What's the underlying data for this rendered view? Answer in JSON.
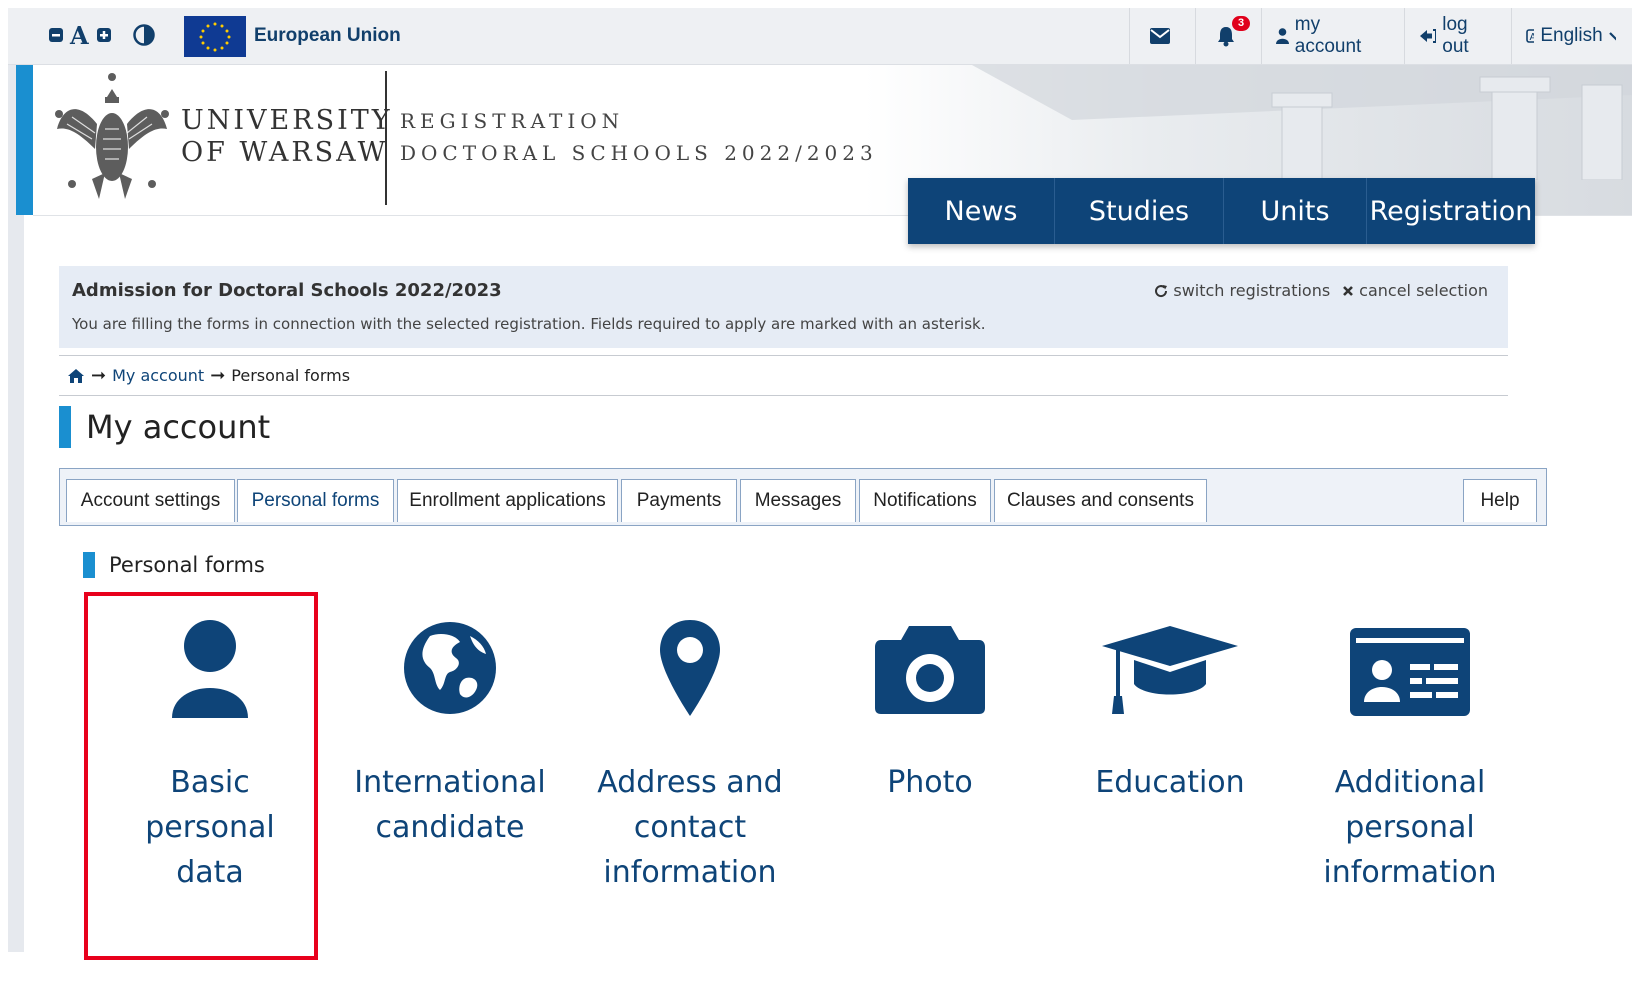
{
  "topbar": {
    "a11y": {
      "font_smaller": "−",
      "font_normal": "A",
      "font_larger": "+",
      "contrast": "◑"
    },
    "eu_label": "European Union",
    "notifications_count": "3",
    "my_account": "my account",
    "log_out": "log out",
    "language": "English"
  },
  "header": {
    "university_line1": "UNIVERSITY",
    "university_line2": "OF WARSAW",
    "registration_line1": "REGISTRATION",
    "registration_line2": "DOCTORAL SCHOOLS 2022/2023"
  },
  "mainnav": [
    "News",
    "Studies",
    "Units",
    "Registration"
  ],
  "info": {
    "title": "Admission for Doctoral Schools 2022/2023",
    "text": "You are filling the forms in connection with the selected registration. Fields required to apply are marked with an asterisk.",
    "switch": "switch registrations",
    "cancel": "cancel selection"
  },
  "breadcrumb": {
    "level1": "My account",
    "level2": "Personal forms"
  },
  "page_title": "My account",
  "tabs": [
    "Account settings",
    "Personal forms",
    "Enrollment applications",
    "Payments",
    "Messages",
    "Notifications",
    "Clauses and consents",
    "Help"
  ],
  "section_title": "Personal forms",
  "tiles": [
    {
      "line1": "Basic",
      "line2": "personal",
      "line3": "data",
      "icon": "user-icon"
    },
    {
      "line1": "International",
      "line2": "candidate",
      "line3": "",
      "icon": "globe-icon"
    },
    {
      "line1": "Address and",
      "line2": "contact",
      "line3": "information",
      "icon": "map-marker-icon"
    },
    {
      "line1": "Photo",
      "line2": "",
      "line3": "",
      "icon": "camera-icon"
    },
    {
      "line1": "Education",
      "line2": "",
      "line3": "",
      "icon": "graduation-cap-icon"
    },
    {
      "line1": "Additional",
      "line2": "personal",
      "line3": "information",
      "icon": "id-card-icon"
    }
  ],
  "colors": {
    "primary": "#0e4478",
    "accent": "#1a8fd0",
    "highlight": "#e8001c"
  }
}
